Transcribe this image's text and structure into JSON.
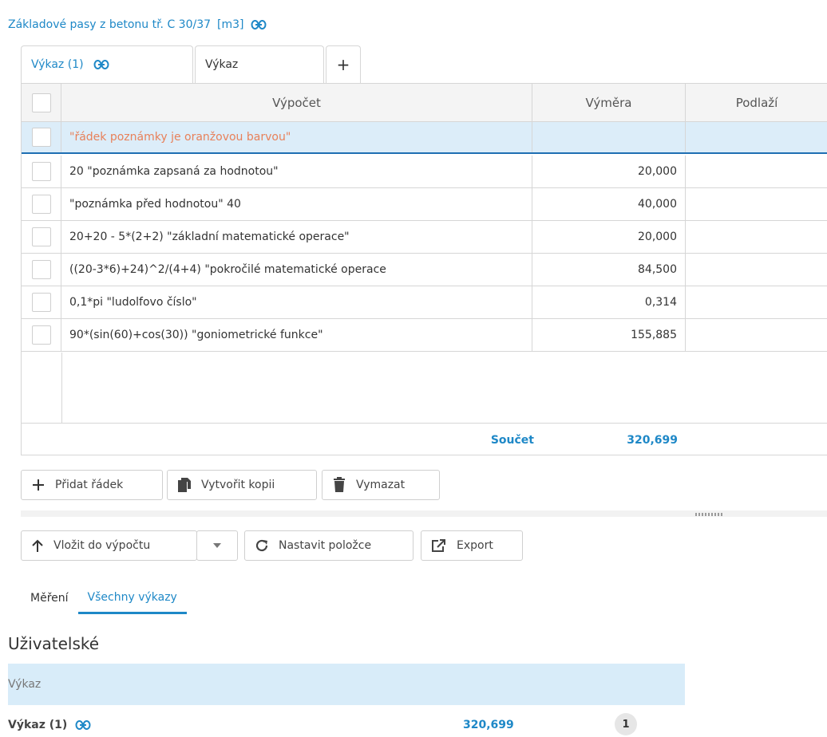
{
  "header": {
    "title": "Základové pasy z betonu tř. C 30/37",
    "unit": "[m3]",
    "link_icon": "link-icon"
  },
  "tabs": [
    {
      "label": "Výkaz (1)",
      "active": true,
      "icon": "link-icon"
    },
    {
      "label": "Výkaz",
      "active": false
    },
    {
      "label": "+",
      "type": "add"
    }
  ],
  "grid": {
    "columns": [
      "Výpočet",
      "Výměra",
      "Podlaží"
    ],
    "rows": [
      {
        "formula": "\"řádek poznámky je oranžovou barvou\"",
        "value": "",
        "floor": "",
        "type": "note"
      },
      {
        "formula": "20 \"poznámka zapsaná za hodnotou\"",
        "value": "20,000",
        "floor": ""
      },
      {
        "formula": "\"poznámka před hodnotou\" 40",
        "value": "40,000",
        "floor": ""
      },
      {
        "formula": "20+20 - 5*(2+2) \"základní matematické operace\"",
        "value": "20,000",
        "floor": ""
      },
      {
        "formula": "((20-3*6)+24)^2/(4+4) \"pokročilé matematické operace",
        "value": "84,500",
        "floor": ""
      },
      {
        "formula": "0,1*pi \"ludolfovo číslo\"",
        "value": "0,314",
        "floor": ""
      },
      {
        "formula": "90*(sin(60)+cos(30)) \"goniometrické funkce\"",
        "value": "155,885",
        "floor": ""
      }
    ],
    "sum_label": "Součet",
    "sum_value": "320,699"
  },
  "toolbar": {
    "add_row": "Přidat řádek",
    "copy": "Vytvořit kopii",
    "delete": "Vymazat",
    "insert": "Vložit do výpočtu",
    "set_item": "Nastavit položce",
    "export": "Export"
  },
  "subtabs": [
    {
      "label": "Měření",
      "active": false
    },
    {
      "label": "Všechny výkazy",
      "active": true
    }
  ],
  "section": {
    "title": "Uživatelské",
    "list_header": "Výkaz",
    "items": [
      {
        "name": "Výkaz (1)",
        "value": "320,699",
        "count": "1"
      }
    ]
  },
  "colors": {
    "accent": "#1e88c7",
    "note_text": "#e8815a",
    "note_bg": "#dcedf9"
  }
}
